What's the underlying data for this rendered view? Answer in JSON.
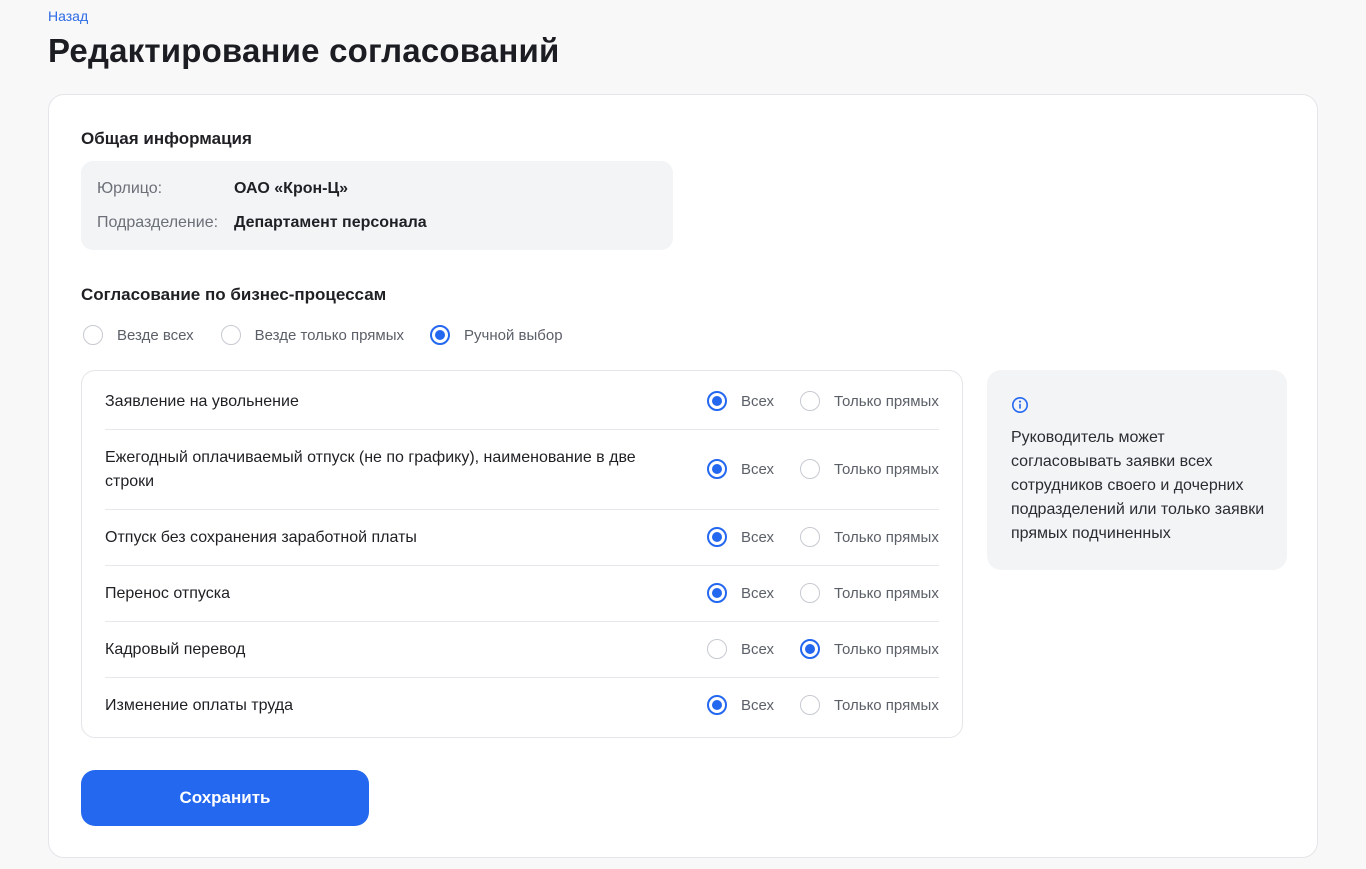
{
  "nav": {
    "back_label": "Назад"
  },
  "page": {
    "title": "Редактирование согласований"
  },
  "general": {
    "title": "Общая информация",
    "rows": [
      {
        "label": "Юрлицо:",
        "value": "ОАО «Крон-Ц»"
      },
      {
        "label": "Подразделение:",
        "value": "Департамент персонала"
      }
    ]
  },
  "business": {
    "title": "Согласование по бизнес-процессам",
    "modes": [
      {
        "label": "Везде всех",
        "checked": false
      },
      {
        "label": "Везде только прямых",
        "checked": false
      },
      {
        "label": "Ручной выбор",
        "checked": true
      }
    ],
    "option_all_label": "Всех",
    "option_direct_label": "Только прямых",
    "processes": [
      {
        "name": "Заявление на увольнение",
        "selected": "all"
      },
      {
        "name": "Ежегодный оплачиваемый отпуск (не по графику), наименование в две строки",
        "selected": "all"
      },
      {
        "name": "Отпуск без сохранения заработной платы",
        "selected": "all"
      },
      {
        "name": "Перенос отпуска",
        "selected": "all"
      },
      {
        "name": "Кадровый перевод",
        "selected": "direct"
      },
      {
        "name": "Изменение оплаты труда",
        "selected": "all"
      }
    ]
  },
  "hint": {
    "icon": "info-icon",
    "text": "Руководитель может согласовывать заявки всех сотрудников своего и дочерних подразделений или только заявки прямых подчиненных"
  },
  "actions": {
    "save_label": "Сохранить"
  },
  "colors": {
    "accent": "#2468f0",
    "link": "#2d6ae3",
    "panel": "#f3f4f6"
  }
}
